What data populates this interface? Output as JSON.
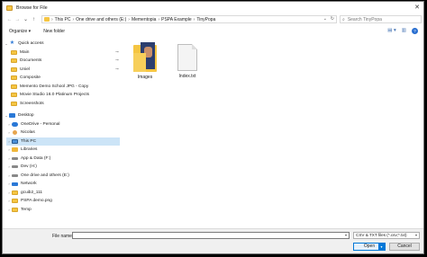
{
  "window": {
    "title": "Browse for File",
    "close_glyph": "✕"
  },
  "nav_buttons": {
    "back": "←",
    "forward": "→",
    "recent": "⌄",
    "up": "↑"
  },
  "address": {
    "crumbs": [
      "This PC",
      "One drive and others (E:)",
      "Mementopia",
      "PSPA Example",
      "TinyPopa"
    ],
    "separator": "›",
    "dropdown_glyph": "⌄",
    "refresh_glyph": "↻"
  },
  "search": {
    "placeholder": "Search TinyPopa",
    "icon_glyph": "⌕"
  },
  "commands": {
    "organize": "Organize ▾",
    "new_folder": "New folder"
  },
  "view_controls": {
    "view_glyph": "▤ ▾",
    "pane_glyph": "▥",
    "help_glyph": "?"
  },
  "sidebar": {
    "items": [
      {
        "label": "Quick access",
        "icon": "star-icon",
        "chevron": "⌄",
        "pinned": false
      },
      {
        "label": "Main",
        "icon": "folder-icon",
        "chevron": "",
        "pinned": true
      },
      {
        "label": "Documents",
        "icon": "folder-icon",
        "chevron": "",
        "pinned": true
      },
      {
        "label": "Uniel",
        "icon": "folder-icon",
        "chevron": "",
        "pinned": true
      },
      {
        "label": "Composite",
        "icon": "folder-icon",
        "chevron": "",
        "pinned": false
      },
      {
        "label": "Memento Demo School JPG - Copy",
        "icon": "folder-icon",
        "chevron": "",
        "pinned": false
      },
      {
        "label": "Movie Studio 16.0 Platinum Projects",
        "icon": "folder-icon",
        "chevron": "",
        "pinned": false
      },
      {
        "label": "Screenshots",
        "icon": "folder-icon",
        "chevron": "",
        "pinned": false
      },
      {
        "label": "Desktop",
        "icon": "desktop-icon",
        "chevron": "⌄",
        "pinned": false
      },
      {
        "label": "OneDrive - Personal",
        "icon": "cloud-icon",
        "chevron": "›",
        "pinned": false
      },
      {
        "label": "Nicolas",
        "icon": "user-icon",
        "chevron": "›",
        "pinned": false
      },
      {
        "label": "This PC",
        "icon": "pc-icon",
        "chevron": "›",
        "pinned": false
      },
      {
        "label": "Libraries",
        "icon": "library-icon",
        "chevron": "›",
        "pinned": false
      },
      {
        "label": "App & Data (F:)",
        "icon": "drive-icon",
        "chevron": "›",
        "pinned": false
      },
      {
        "label": "Dev (H:)",
        "icon": "drive-icon",
        "chevron": "›",
        "pinned": false
      },
      {
        "label": "One drive and others (E:)",
        "icon": "drive-icon",
        "chevron": "›",
        "pinned": false
      },
      {
        "label": "Network",
        "icon": "network-icon",
        "chevron": "›",
        "pinned": false
      },
      {
        "label": "gcuib2_111",
        "icon": "folder-icon",
        "chevron": "›",
        "pinned": false
      },
      {
        "label": "PSPA demo.png",
        "icon": "folder-icon",
        "chevron": "›",
        "pinned": false
      },
      {
        "label": "Temp",
        "icon": "folder-icon",
        "chevron": "›",
        "pinned": false
      }
    ],
    "pin_glyph": "⊸",
    "selected_index": 11
  },
  "files": [
    {
      "name": "Images",
      "type": "folder"
    },
    {
      "name": "Index.txt",
      "type": "text"
    }
  ],
  "footer": {
    "file_name_label": "File name:",
    "file_name_value": "",
    "filter_value": "CSV & TXT files (*.csv;*.txt)",
    "open_label": "Open",
    "cancel_label": "Cancel",
    "dropdown_glyph": "▾"
  },
  "colors": {
    "selection": "#cce4f7",
    "folder": "#f5c542",
    "accent": "#0078d7"
  }
}
